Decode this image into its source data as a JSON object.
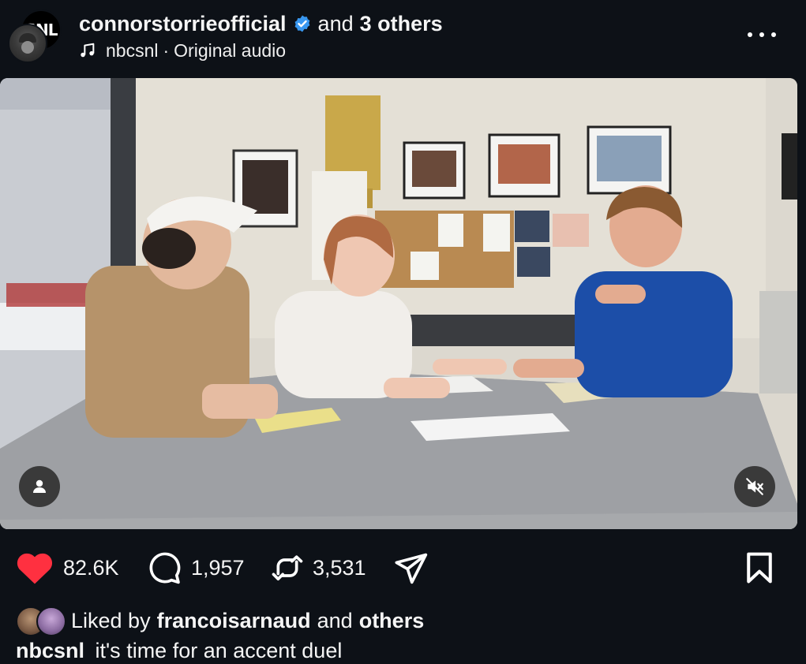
{
  "header": {
    "username": "connorstorrieofficial",
    "and_text": "and",
    "others_text": "3 others",
    "audio_source": "nbcsnl",
    "audio_separator": "·",
    "audio_label": "Original audio",
    "snl_avatar_label": "SNL"
  },
  "actions": {
    "likes": "82.6K",
    "comments": "1,957",
    "reposts": "3,531"
  },
  "likes_line": {
    "prefix": "Liked by",
    "user": "francoisarnaud",
    "and_text": "and",
    "others": "others"
  },
  "caption": {
    "user": "nbcsnl",
    "text": "it's time for an accent duel"
  },
  "colors": {
    "background": "#0d1117",
    "like_red": "#ff3040",
    "verified_blue": "#3897f0"
  },
  "icons": {
    "more": "more-horizontal-icon",
    "verified": "verified-badge-icon",
    "music": "music-note-icon",
    "tag_users": "person-icon",
    "mute": "speaker-muted-icon",
    "like": "heart-icon",
    "comment": "comment-icon",
    "repost": "repost-icon",
    "share": "send-icon",
    "save": "bookmark-icon"
  }
}
